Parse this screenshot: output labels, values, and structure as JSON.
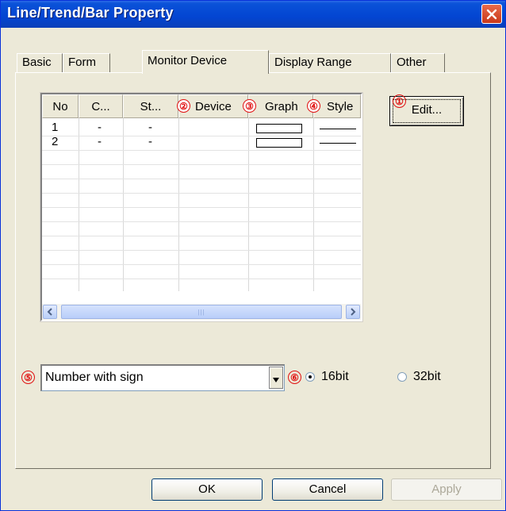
{
  "window": {
    "title": "Line/Trend/Bar Property"
  },
  "tabs": [
    {
      "label": "Basic",
      "active": false
    },
    {
      "label": "Form",
      "active": false
    },
    {
      "label": "Monitor Device",
      "active": true
    },
    {
      "label": "Display Range",
      "active": false
    },
    {
      "label": "Other",
      "active": false
    }
  ],
  "table": {
    "columns": [
      "No",
      "C...",
      "St...",
      "Device",
      "Graph",
      "Style"
    ],
    "rows": [
      {
        "no": "1",
        "c": "-",
        "st": "-",
        "device": ""
      },
      {
        "no": "2",
        "c": "-",
        "st": "-",
        "device": ""
      }
    ]
  },
  "edit_button": {
    "label": "Edit..."
  },
  "combo": {
    "value": "Number with sign"
  },
  "radios": [
    {
      "label": "16bit",
      "checked": true
    },
    {
      "label": "32bit",
      "checked": false
    }
  ],
  "markers": [
    "①",
    "②",
    "③",
    "④",
    "⑤",
    "⑥"
  ],
  "buttons": {
    "ok": "OK",
    "cancel": "Cancel",
    "apply": "Apply"
  },
  "colors": {
    "title_bar": "#0345D2",
    "dialog_bg": "#ECE9D8",
    "marker": "#E01010"
  }
}
